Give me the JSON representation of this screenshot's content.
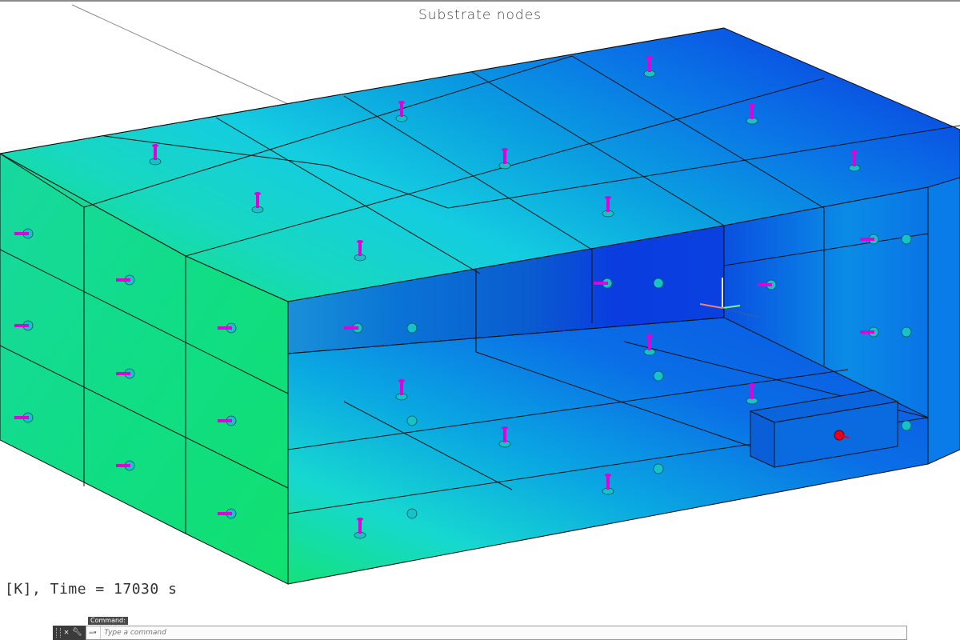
{
  "viewport": {
    "title": "Substrate nodes",
    "status_text": "[K], Time = 17030 s"
  },
  "command_line": {
    "label": "Command:",
    "placeholder": "Type a command",
    "close_icon": "close-icon",
    "customize_icon": "wrench-icon",
    "prompt_icon": "command-prompt-icon"
  },
  "colors": {
    "green": "#13e27a",
    "cyan": "#17d8d0",
    "mid_blue": "#0aa0e0",
    "blue": "#0a6ee6",
    "deep_blue": "#0a44e0",
    "node_magenta": "#e100d8",
    "node_cyan": "#16c2c8",
    "node_red": "#e8001a"
  }
}
